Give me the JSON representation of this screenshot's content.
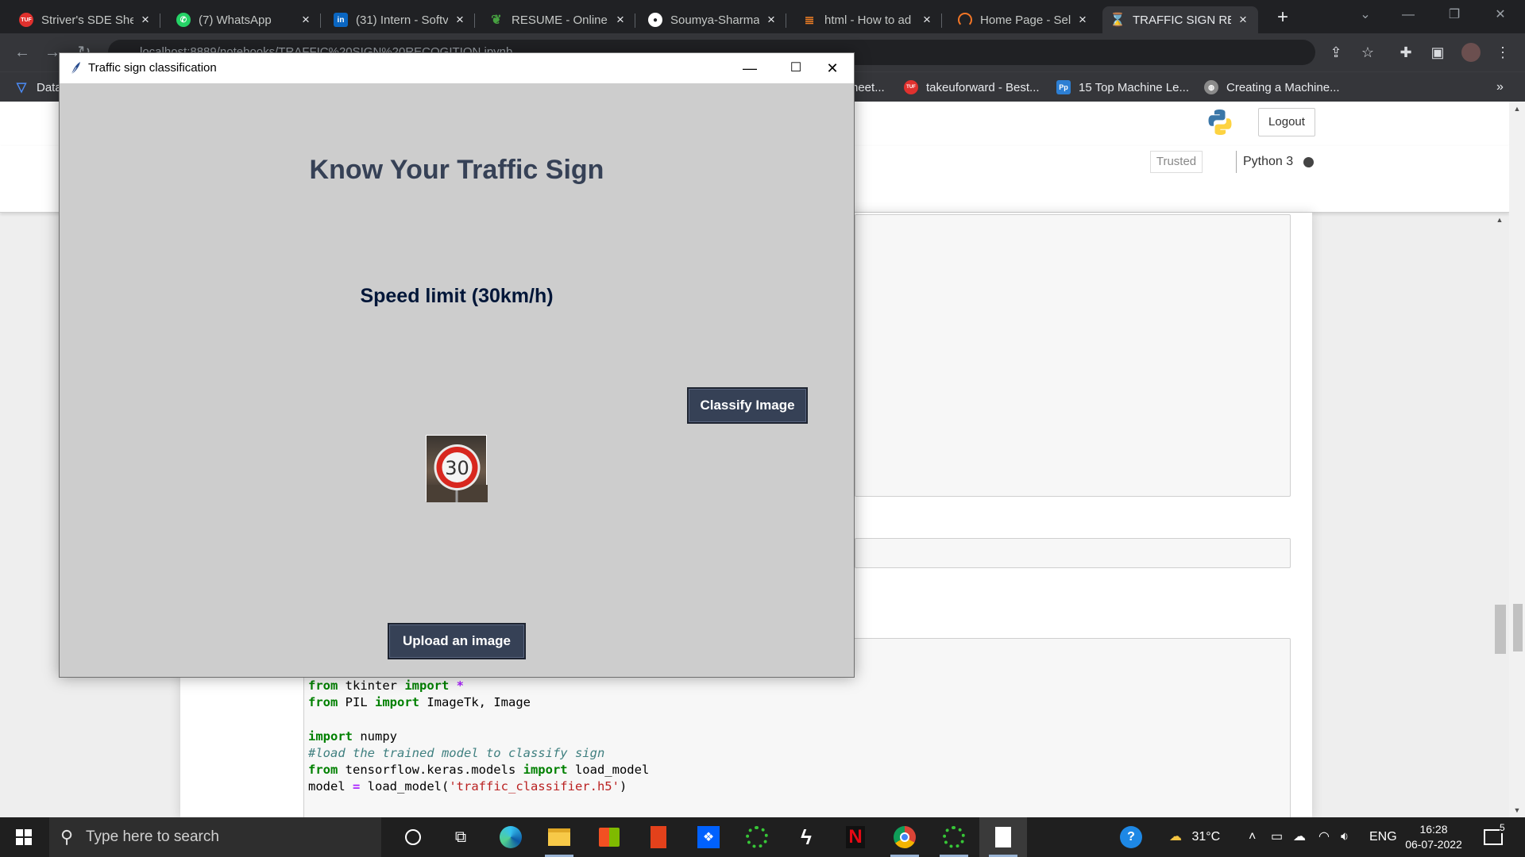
{
  "browser": {
    "tabs": [
      {
        "title": "Striver's SDE Shee",
        "icon": "tuf-icon",
        "color": "#e0312e"
      },
      {
        "title": "(7) WhatsApp",
        "icon": "whatsapp-icon",
        "color": "#25d366"
      },
      {
        "title": "(31) Intern - Softv",
        "icon": "linkedin-icon",
        "color": "#0a66c2"
      },
      {
        "title": "RESUME - Online",
        "icon": "overleaf-icon",
        "color": "#47a141"
      },
      {
        "title": "Soumya-Sharma-",
        "icon": "github-icon",
        "color": "#ffffff"
      },
      {
        "title": "html - How to ad",
        "icon": "stackoverflow-icon",
        "color": "#f48024"
      },
      {
        "title": "Home Page - Sel",
        "icon": "selenium-icon",
        "color": "#f37626"
      },
      {
        "title": "TRAFFIC SIGN RE",
        "icon": "jupyter-icon",
        "color": "#f37626"
      }
    ],
    "active_tab": 7,
    "url": "localhost:8889/notebooks/TRAFFIC%20SIGN%20RECOGITION.ipynb",
    "bookmarks": [
      {
        "label": "Data",
        "icon": "bookmark-triangle-icon",
        "color": "#4c8bf5"
      },
      {
        "label": "heet...",
        "icon": "bookmark-icon",
        "color": "#888888"
      },
      {
        "label": "takeuforward - Best...",
        "icon": "tuf-icon",
        "color": "#e0312e"
      },
      {
        "label": "15 Top Machine Le...",
        "icon": "pp-icon",
        "color": "#2d7fd3"
      },
      {
        "label": "Creating a Machine...",
        "icon": "globe-icon",
        "color": "#8a8a8a"
      }
    ]
  },
  "jupyter": {
    "logout_label": "Logout",
    "trusted_label": "Trusted",
    "kernel_label": "Python 3",
    "header_fragment": ")",
    "code_lines": [
      [
        [
          "kw",
          "from"
        ],
        [
          "t",
          " tkinter "
        ],
        [
          "kw",
          "import"
        ],
        [
          "op",
          " *"
        ]
      ],
      [
        [
          "kw",
          "from"
        ],
        [
          "t",
          " PIL "
        ],
        [
          "kw",
          "import"
        ],
        [
          "t",
          " ImageTk, Image"
        ]
      ],
      [
        [
          "t",
          ""
        ]
      ],
      [
        [
          "kw",
          "import"
        ],
        [
          "t",
          " numpy"
        ]
      ],
      [
        [
          "cm",
          "#load the trained model to classify sign"
        ]
      ],
      [
        [
          "kw",
          "from"
        ],
        [
          "t",
          " tensorflow.keras.models "
        ],
        [
          "kw",
          "import"
        ],
        [
          "t",
          " load_model"
        ]
      ],
      [
        [
          "t",
          "model "
        ],
        [
          "op",
          "="
        ],
        [
          "t",
          " load_model("
        ],
        [
          "st",
          "'traffic_classifier.h5'"
        ],
        [
          "t",
          ")"
        ]
      ]
    ]
  },
  "tkapp": {
    "window_title": "Traffic sign classification",
    "heading": "Know Your Traffic Sign",
    "result": "Speed limit (30km/h)",
    "classify_label": "Classify Image",
    "upload_label": "Upload an image",
    "sign_value": "30",
    "colors": {
      "bg": "#cdcdcd",
      "button": "#364156",
      "heading": "#364156",
      "result": "#011638"
    }
  },
  "taskbar": {
    "search_placeholder": "Type here to search",
    "weather": "31°C",
    "language": "ENG",
    "time": "16:28",
    "date": "06-07-2022",
    "notification_count": "5"
  }
}
